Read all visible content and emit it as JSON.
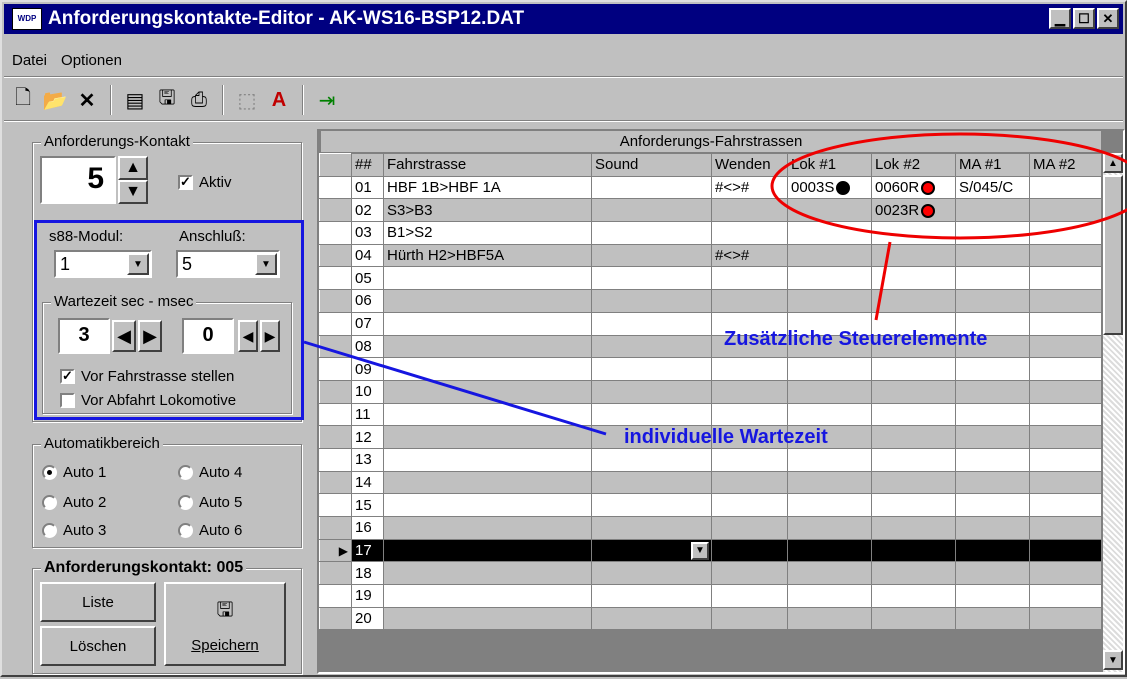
{
  "window": {
    "title": "Anforderungskontakte-Editor - AK-WS16-BSP12.DAT",
    "icon_text": "WDP"
  },
  "menu": [
    {
      "label": "Datei"
    },
    {
      "label": "Optionen"
    }
  ],
  "toolbar": [
    "new-icon",
    "open-icon",
    "delete-icon",
    "form-icon",
    "save-icon",
    "print-icon",
    "grid-icon",
    "color-icon",
    "exit-icon"
  ],
  "left": {
    "contact_group": "Anforderungs-Kontakt",
    "contact_number": "5",
    "aktiv_label": "Aktiv",
    "aktiv_checked": true,
    "s88_label": "s88-Modul:",
    "anschluss_label": "Anschluß:",
    "s88_value": "1",
    "anschluss_value": "5",
    "wartezeit_label": "Wartezeit  sec - msec",
    "sec_value": "3",
    "msec_value": "0",
    "vor_fahrstrasse": "Vor Fahrstrasse stellen",
    "vor_fahrstrasse_checked": true,
    "vor_abfahrt": "Vor Abfahrt Lokomotive",
    "auto_group": "Automatikbereich",
    "autos": [
      "Auto 1",
      "Auto 4",
      "Auto 2",
      "Auto 5",
      "Auto 3",
      "Auto 6"
    ],
    "selected_auto": "Auto 1",
    "ak_group": "Anforderungskontakt: 005",
    "liste": "Liste",
    "loeschen": "Löschen",
    "speichern": "Speichern"
  },
  "grid": {
    "title": "Anforderungs-Fahrstrassen",
    "headers": [
      "##",
      "Fahrstrasse",
      "Sound",
      "Wenden",
      "Lok #1",
      "Lok #2",
      "MA #1",
      "MA #2"
    ],
    "rows": [
      {
        "n": "01",
        "fahr": "HBF 1B>HBF 1A",
        "sound": "",
        "wenden": "#<>#",
        "lok1": "0003S",
        "lok1c": "#000000",
        "lok2": "0060R",
        "lok2c": "#ff0000",
        "ma1": "S/045/C",
        "ma2": ""
      },
      {
        "n": "02",
        "fahr": "S3>B3",
        "sound": "",
        "wenden": "",
        "lok1": "",
        "lok1c": "",
        "lok2": "0023R",
        "lok2c": "#ff0000",
        "ma1": "",
        "ma2": ""
      },
      {
        "n": "03",
        "fahr": "B1>S2",
        "sound": "",
        "wenden": "",
        "lok1": "",
        "lok1c": "",
        "lok2": "",
        "lok2c": "",
        "ma1": "",
        "ma2": ""
      },
      {
        "n": "04",
        "fahr": "Hürth H2>HBF5A",
        "sound": "",
        "wenden": "#<>#",
        "lok1": "",
        "lok1c": "",
        "lok2": "",
        "lok2c": "",
        "ma1": "",
        "ma2": ""
      },
      {
        "n": "05"
      },
      {
        "n": "06"
      },
      {
        "n": "07"
      },
      {
        "n": "08"
      },
      {
        "n": "09"
      },
      {
        "n": "10"
      },
      {
        "n": "11"
      },
      {
        "n": "12"
      },
      {
        "n": "13"
      },
      {
        "n": "14"
      },
      {
        "n": "15"
      },
      {
        "n": "16"
      },
      {
        "n": "17",
        "selected": true
      },
      {
        "n": "18"
      },
      {
        "n": "19"
      },
      {
        "n": "20"
      }
    ]
  },
  "annotations": {
    "steuer": "Zusätzliche Steuerelemente",
    "warte": "individuelle Wartezeit"
  },
  "colors": {
    "annotation_blue": "#1616e0",
    "annotation_red": "#ee0000"
  }
}
